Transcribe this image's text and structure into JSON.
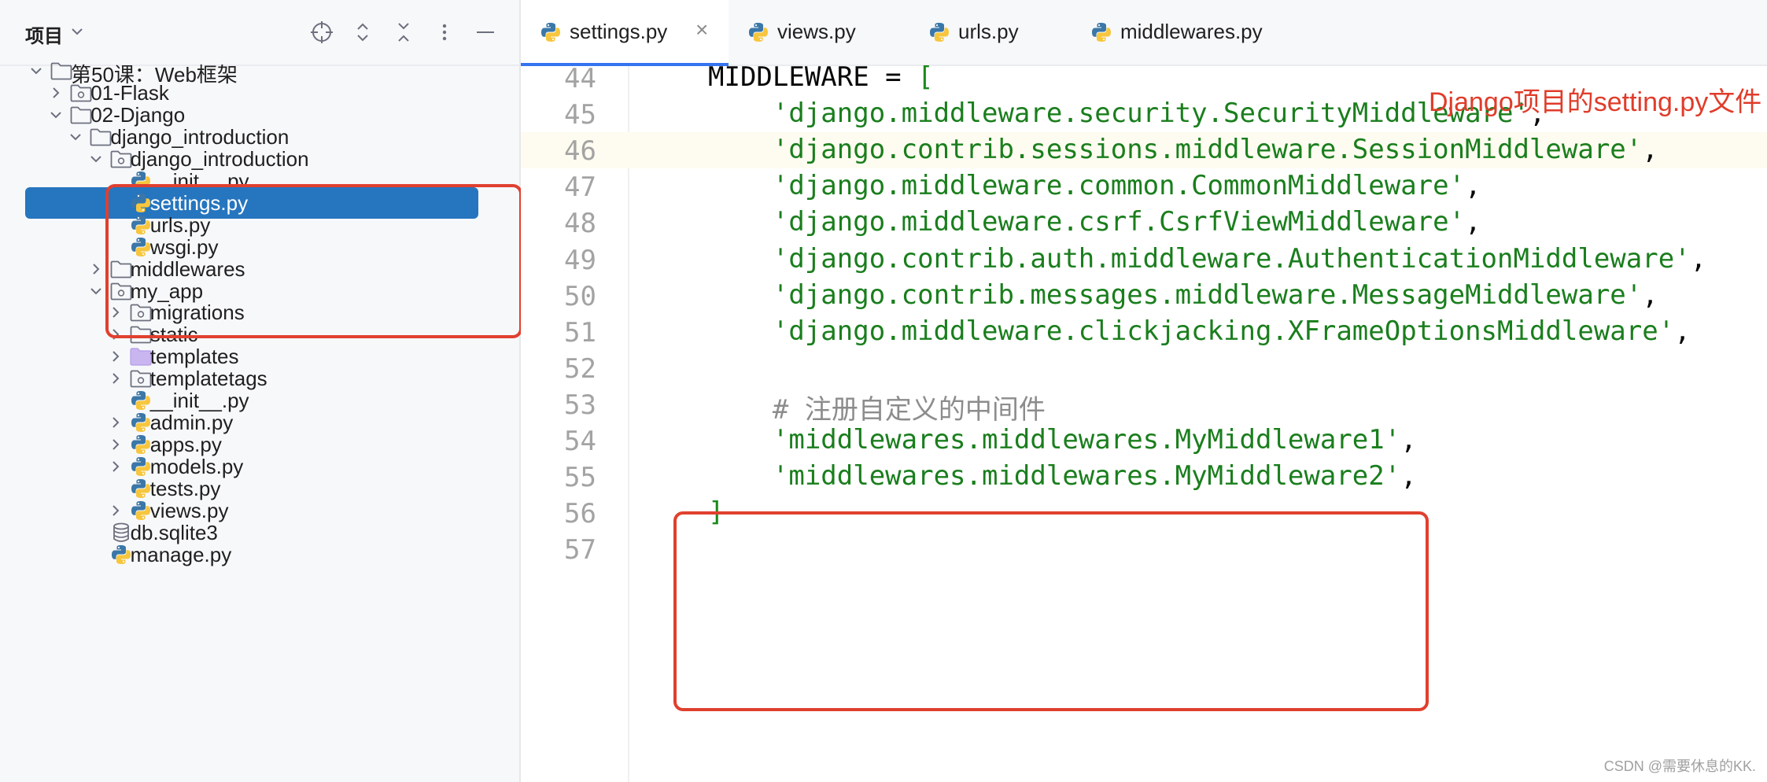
{
  "project_panel": {
    "title": "项目",
    "header_icons": [
      "crosshair-icon",
      "expand-all-icon",
      "collapse-all-icon",
      "more-vert-icon",
      "minimize-icon"
    ],
    "tree": [
      {
        "label": "第50课：Web框架",
        "depth": 0,
        "kind": "folder",
        "state": "expanded"
      },
      {
        "label": "01-Flask",
        "depth": 1,
        "kind": "module",
        "state": "collapsed"
      },
      {
        "label": "02-Django",
        "depth": 1,
        "kind": "folder",
        "state": "expanded"
      },
      {
        "label": "django_introduction",
        "depth": 2,
        "kind": "folder",
        "state": "expanded"
      },
      {
        "label": "django_introduction",
        "depth": 3,
        "kind": "module",
        "state": "expanded"
      },
      {
        "label": "__init__.py",
        "depth": 4,
        "kind": "python",
        "state": "none"
      },
      {
        "label": "settings.py",
        "depth": 4,
        "kind": "python",
        "state": "none",
        "selected": true
      },
      {
        "label": "urls.py",
        "depth": 4,
        "kind": "python",
        "state": "none"
      },
      {
        "label": "wsgi.py",
        "depth": 4,
        "kind": "python",
        "state": "none"
      },
      {
        "label": "middlewares",
        "depth": 3,
        "kind": "folder",
        "state": "collapsed"
      },
      {
        "label": "my_app",
        "depth": 3,
        "kind": "module",
        "state": "expanded"
      },
      {
        "label": "migrations",
        "depth": 4,
        "kind": "module",
        "state": "collapsed"
      },
      {
        "label": "static",
        "depth": 4,
        "kind": "folder",
        "state": "collapsed"
      },
      {
        "label": "templates",
        "depth": 4,
        "kind": "template-folder",
        "state": "collapsed"
      },
      {
        "label": "templatetags",
        "depth": 4,
        "kind": "module",
        "state": "collapsed"
      },
      {
        "label": "__init__.py",
        "depth": 4,
        "kind": "python",
        "state": "none"
      },
      {
        "label": "admin.py",
        "depth": 4,
        "kind": "python",
        "state": "collapsed"
      },
      {
        "label": "apps.py",
        "depth": 4,
        "kind": "python",
        "state": "collapsed"
      },
      {
        "label": "models.py",
        "depth": 4,
        "kind": "python",
        "state": "collapsed"
      },
      {
        "label": "tests.py",
        "depth": 4,
        "kind": "python",
        "state": "none"
      },
      {
        "label": "views.py",
        "depth": 4,
        "kind": "python",
        "state": "collapsed"
      },
      {
        "label": "db.sqlite3",
        "depth": 3,
        "kind": "database",
        "state": "none"
      },
      {
        "label": "manage.py",
        "depth": 3,
        "kind": "python",
        "state": "none"
      }
    ]
  },
  "editor": {
    "tabs": [
      {
        "label": "settings.py",
        "active": true,
        "closable": true
      },
      {
        "label": "views.py",
        "active": false
      },
      {
        "label": "urls.py",
        "active": false
      },
      {
        "label": "middlewares.py",
        "active": false
      }
    ],
    "annotation": "Django项目的setting.py文件",
    "lines": [
      {
        "num": "44",
        "parts": [
          {
            "t": "MIDDLEWARE = ",
            "c": "plain"
          },
          {
            "t": "[",
            "c": "brk"
          }
        ]
      },
      {
        "num": "45",
        "parts": [
          {
            "t": "    'django.middleware.security.SecurityMiddleware'",
            "c": "str"
          },
          {
            "t": ",",
            "c": "plain"
          }
        ]
      },
      {
        "num": "46",
        "highlight": true,
        "parts": [
          {
            "t": "    'django.contrib.sessions.middleware.SessionMiddleware'",
            "c": "str"
          },
          {
            "t": ",",
            "c": "plain"
          }
        ]
      },
      {
        "num": "47",
        "parts": [
          {
            "t": "    'django.middleware.common.CommonMiddleware'",
            "c": "str"
          },
          {
            "t": ",",
            "c": "plain"
          }
        ]
      },
      {
        "num": "48",
        "parts": [
          {
            "t": "    'django.middleware.csrf.CsrfViewMiddleware'",
            "c": "str"
          },
          {
            "t": ",",
            "c": "plain"
          }
        ]
      },
      {
        "num": "49",
        "parts": [
          {
            "t": "    'django.contrib.auth.middleware.AuthenticationMiddleware'",
            "c": "str"
          },
          {
            "t": ",",
            "c": "plain"
          }
        ]
      },
      {
        "num": "50",
        "parts": [
          {
            "t": "    'django.contrib.messages.middleware.MessageMiddleware'",
            "c": "str"
          },
          {
            "t": ",",
            "c": "plain"
          }
        ]
      },
      {
        "num": "51",
        "parts": [
          {
            "t": "    'django.middleware.clickjacking.XFrameOptionsMiddleware'",
            "c": "str"
          },
          {
            "t": ",",
            "c": "plain"
          }
        ]
      },
      {
        "num": "52",
        "parts": []
      },
      {
        "num": "53",
        "parts": [
          {
            "t": "    # ",
            "c": "comment"
          },
          {
            "t": "注册自定义的中间件",
            "c": "comment-cjk"
          }
        ]
      },
      {
        "num": "54",
        "parts": [
          {
            "t": "    'middlewares.middlewares.MyMiddleware1'",
            "c": "str"
          },
          {
            "t": ",",
            "c": "plain"
          }
        ]
      },
      {
        "num": "55",
        "parts": [
          {
            "t": "    'middlewares.middlewares.MyMiddleware2'",
            "c": "str"
          },
          {
            "t": ",",
            "c": "plain"
          }
        ]
      },
      {
        "num": "56",
        "parts": [
          {
            "t": "]",
            "c": "brk"
          }
        ]
      },
      {
        "num": "57",
        "parts": []
      }
    ]
  },
  "watermark": "CSDN @需要休息的KK.",
  "colors": {
    "selection": "#2675bf",
    "callout_border": "#e0402f",
    "string": "#1a7e1d",
    "comment": "#8c8c8c",
    "line_highlight": "#fefcf0",
    "tab_underline": "#3574f0"
  }
}
